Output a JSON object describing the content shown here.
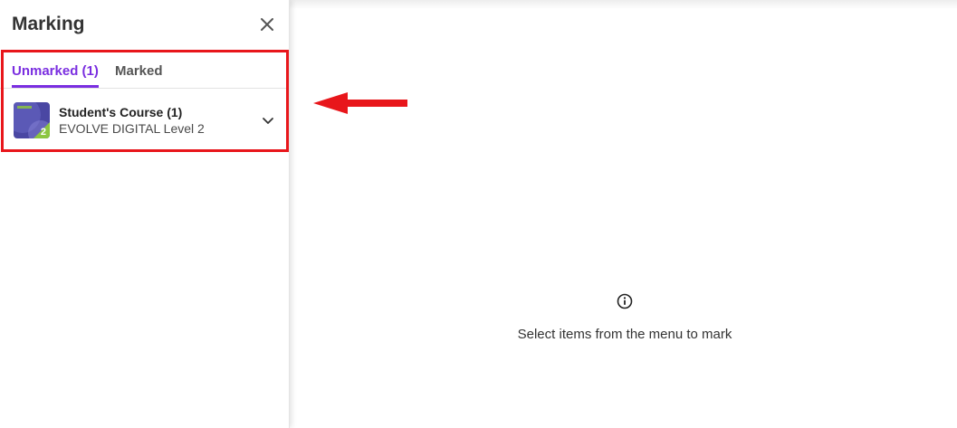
{
  "sidebar": {
    "title": "Marking",
    "tabs": [
      {
        "label": "Unmarked (1)",
        "active": true
      },
      {
        "label": "Marked",
        "active": false
      }
    ],
    "course": {
      "title": "Student's Course (1)",
      "subtitle": "EVOLVE DIGITAL Level 2",
      "thumbnail_badge": "2"
    }
  },
  "main": {
    "empty_message": "Select items from the menu to mark"
  },
  "colors": {
    "accent": "#7a2ee0",
    "highlight": "#e8161b",
    "thumbnail_primary": "#4a47a3",
    "thumbnail_badge": "#8cc63f"
  },
  "icons": {
    "close": "close-icon",
    "expand": "chevron-down-icon",
    "info": "info-icon",
    "annotation": "arrow-left-icon"
  }
}
